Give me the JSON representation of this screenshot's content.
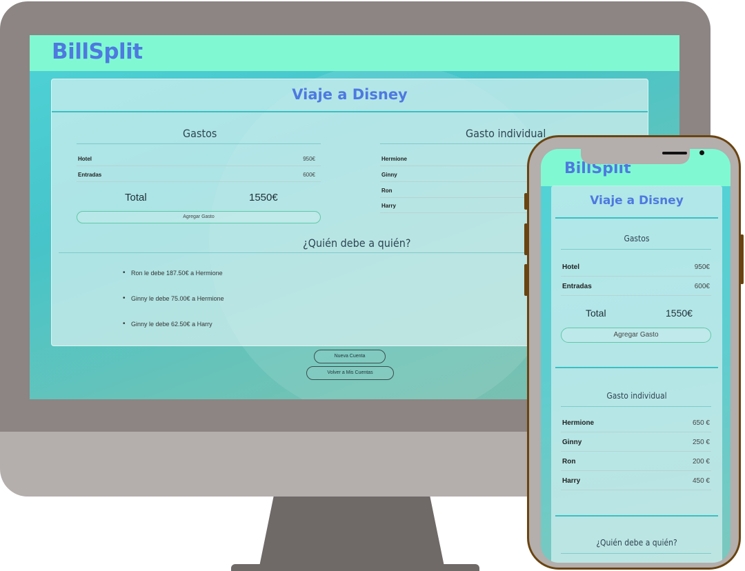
{
  "app": {
    "logo": "BillSplit"
  },
  "page": {
    "title": "Viaje a Disney"
  },
  "expenses": {
    "heading": "Gastos",
    "items": [
      {
        "name": "Hotel",
        "amount": "950€"
      },
      {
        "name": "Entradas",
        "amount": "600€"
      }
    ],
    "total_label": "Total",
    "total_value": "1550€",
    "add_button": "Agregar Gasto"
  },
  "individual": {
    "heading": "Gasto individual",
    "items": [
      {
        "name": "Hermione",
        "amount": "650 €"
      },
      {
        "name": "Ginny",
        "amount": "250 €"
      },
      {
        "name": "Ron",
        "amount": "200 €"
      },
      {
        "name": "Harry",
        "amount": "450 €"
      }
    ]
  },
  "debts": {
    "heading": "¿Quién debe a quién?",
    "items": [
      "Ron le debe 187.50€ a Hermione",
      "Ginny le debe 75.00€ a Hermione",
      "Ginny le debe 62.50€ a Harry"
    ]
  },
  "actions": {
    "new_account": "Nueva Cuenta",
    "back": "Volver a Mis Cuentas"
  },
  "colors": {
    "header_bg": "#80f9d2",
    "accent_blue": "#4e79e0",
    "teal_line": "#38c0c4",
    "phone_frame": "#6a4410"
  }
}
